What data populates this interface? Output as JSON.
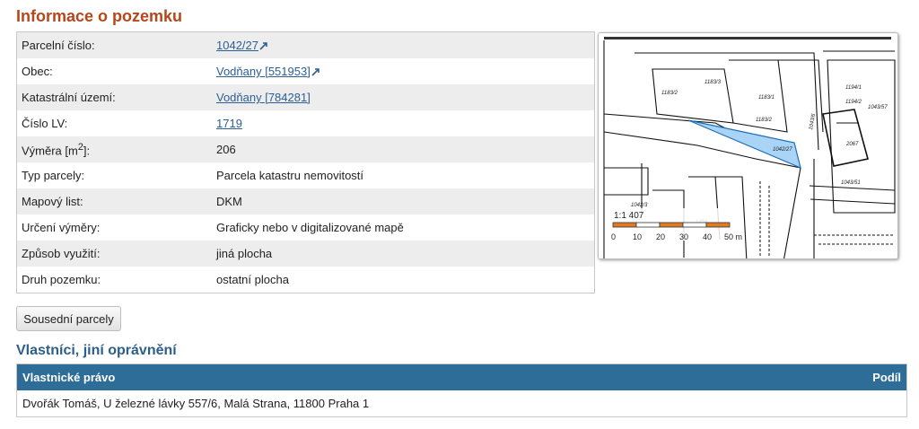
{
  "title": "Informace o pozemku",
  "info": [
    {
      "label": "Parcelní číslo:",
      "value": "1042/27",
      "link": true,
      "external": true
    },
    {
      "label": "Obec:",
      "value": "Vodňany [551953]",
      "link": true,
      "external": true
    },
    {
      "label": "Katastrální území:",
      "value": "Vodňany [784281]",
      "link": true,
      "external": false
    },
    {
      "label": "Číslo LV:",
      "value": "1719",
      "link": true,
      "external": false
    },
    {
      "label": "Výměra [m",
      "label_sup": "2",
      "label_end": "]:",
      "value": "206",
      "link": false
    },
    {
      "label": "Typ parcely:",
      "value": "Parcela katastru nemovitostí",
      "link": false
    },
    {
      "label": "Mapový list:",
      "value": "DKM",
      "link": false
    },
    {
      "label": "Určení výměry:",
      "value": "Graficky nebo v digitalizované mapě",
      "link": false
    },
    {
      "label": "Způsob využití:",
      "value": "jiná plocha",
      "link": false
    },
    {
      "label": "Druh pozemku:",
      "value": "ostatní plocha",
      "link": false
    }
  ],
  "map": {
    "scale_ratio": "1:1 407",
    "scale_ticks": [
      "0",
      "10",
      "20",
      "30",
      "40",
      "50 m"
    ],
    "parcel_labels": [
      "1183/2",
      "1183/3",
      "1183/1",
      "1183/2",
      "1042/27",
      "1043/6",
      "1042/3",
      "2067",
      "1194/1",
      "1194/2",
      "1043/57",
      "1043/51",
      "1456"
    ],
    "highlight_color": "#a9d4f5"
  },
  "neighbors_button": "Sousední parcely",
  "owners_title": "Vlastníci, jiní oprávnění",
  "owners_table": {
    "col_right": "Vlastnické právo",
    "col_share": "Podíl",
    "rows": [
      {
        "owner": "Dvořák Tomáš, U železné lávky 557/6, Malá Strana, 11800 Praha 1",
        "share": ""
      }
    ]
  }
}
